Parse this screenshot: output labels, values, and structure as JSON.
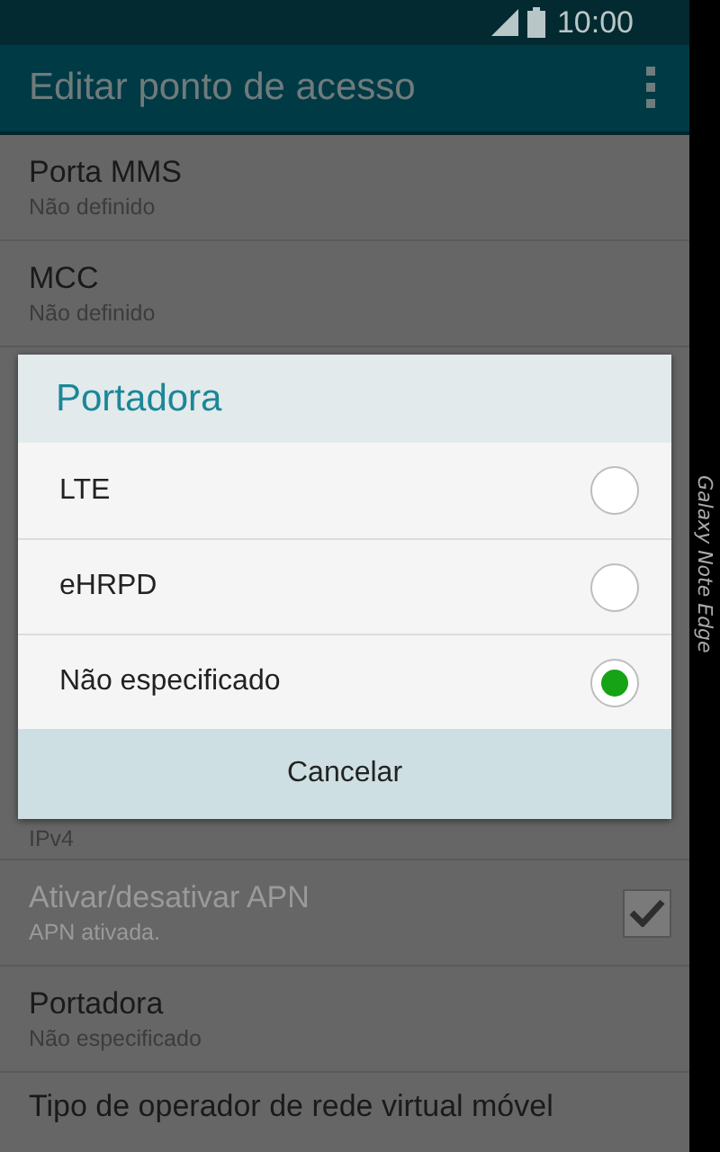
{
  "status_bar": {
    "time": "10:00"
  },
  "app_bar": {
    "title": "Editar ponto de acesso"
  },
  "settings": [
    {
      "kind": "text",
      "title": "Porta MMS",
      "subtitle": "Não definido",
      "disabled": false
    },
    {
      "kind": "text",
      "title": "MCC",
      "subtitle": "Não definido",
      "disabled": false
    },
    {
      "kind": "covered",
      "subtitle": "IPv4"
    },
    {
      "kind": "checkbox",
      "title": "Ativar/desativar APN",
      "subtitle": "APN ativada.",
      "disabled": true,
      "checked": true
    },
    {
      "kind": "text",
      "title": "Portadora",
      "subtitle": "Não especificado",
      "disabled": false
    },
    {
      "kind": "text",
      "title": "Tipo de operador de rede virtual móvel",
      "disabled": false
    }
  ],
  "dialog": {
    "title": "Portadora",
    "options": [
      {
        "label": "LTE",
        "selected": false
      },
      {
        "label": "eHRPD",
        "selected": false
      },
      {
        "label": "Não especificado",
        "selected": true
      }
    ],
    "cancel": "Cancelar"
  },
  "edge_panel": {
    "label": "Galaxy Note Edge"
  }
}
